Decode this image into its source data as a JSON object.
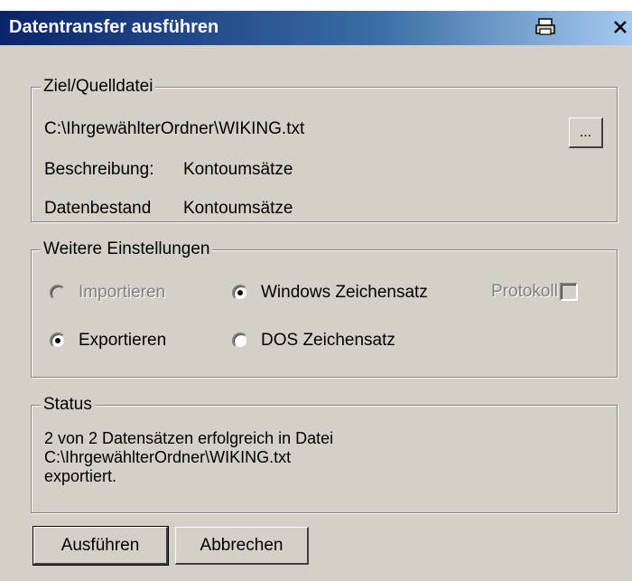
{
  "window": {
    "title": "Datentransfer ausführen"
  },
  "titlebar": {
    "print_glyph": "🖨",
    "close_glyph": "✕"
  },
  "file_group": {
    "title": "Ziel/Quelldatei",
    "path": "C:\\IhrgewählterOrdner\\WIKING.txt",
    "browse_label": "...",
    "description_label": "Beschreibung:",
    "description_value": "Kontoumsätze",
    "dataset_label": "Datenbestand",
    "dataset_value": "Kontoumsätze"
  },
  "settings_group": {
    "title": "Weitere Einstellungen",
    "import_label": "Importieren",
    "export_label": "Exportieren",
    "windows_charset_label": "Windows Zeichensatz",
    "dos_charset_label": "DOS Zeichensatz",
    "protocol_label": "Protokoll",
    "direction_selected": "Exportieren",
    "charset_selected": "Windows Zeichensatz",
    "import_enabled": false,
    "protocol_checked": false
  },
  "status_group": {
    "title": "Status",
    "line1": "2 von 2 Datensätzen erfolgreich in Datei",
    "line2": "C:\\IhrgewählterOrdner\\WIKING.txt",
    "line3": "exportiert."
  },
  "buttons": {
    "execute_label": "Ausführen",
    "cancel_label": "Abbrechen"
  },
  "colors": {
    "dialog_bg": "#d4d0c8",
    "title_start": "#0a246a",
    "title_end": "#a6caf0"
  }
}
